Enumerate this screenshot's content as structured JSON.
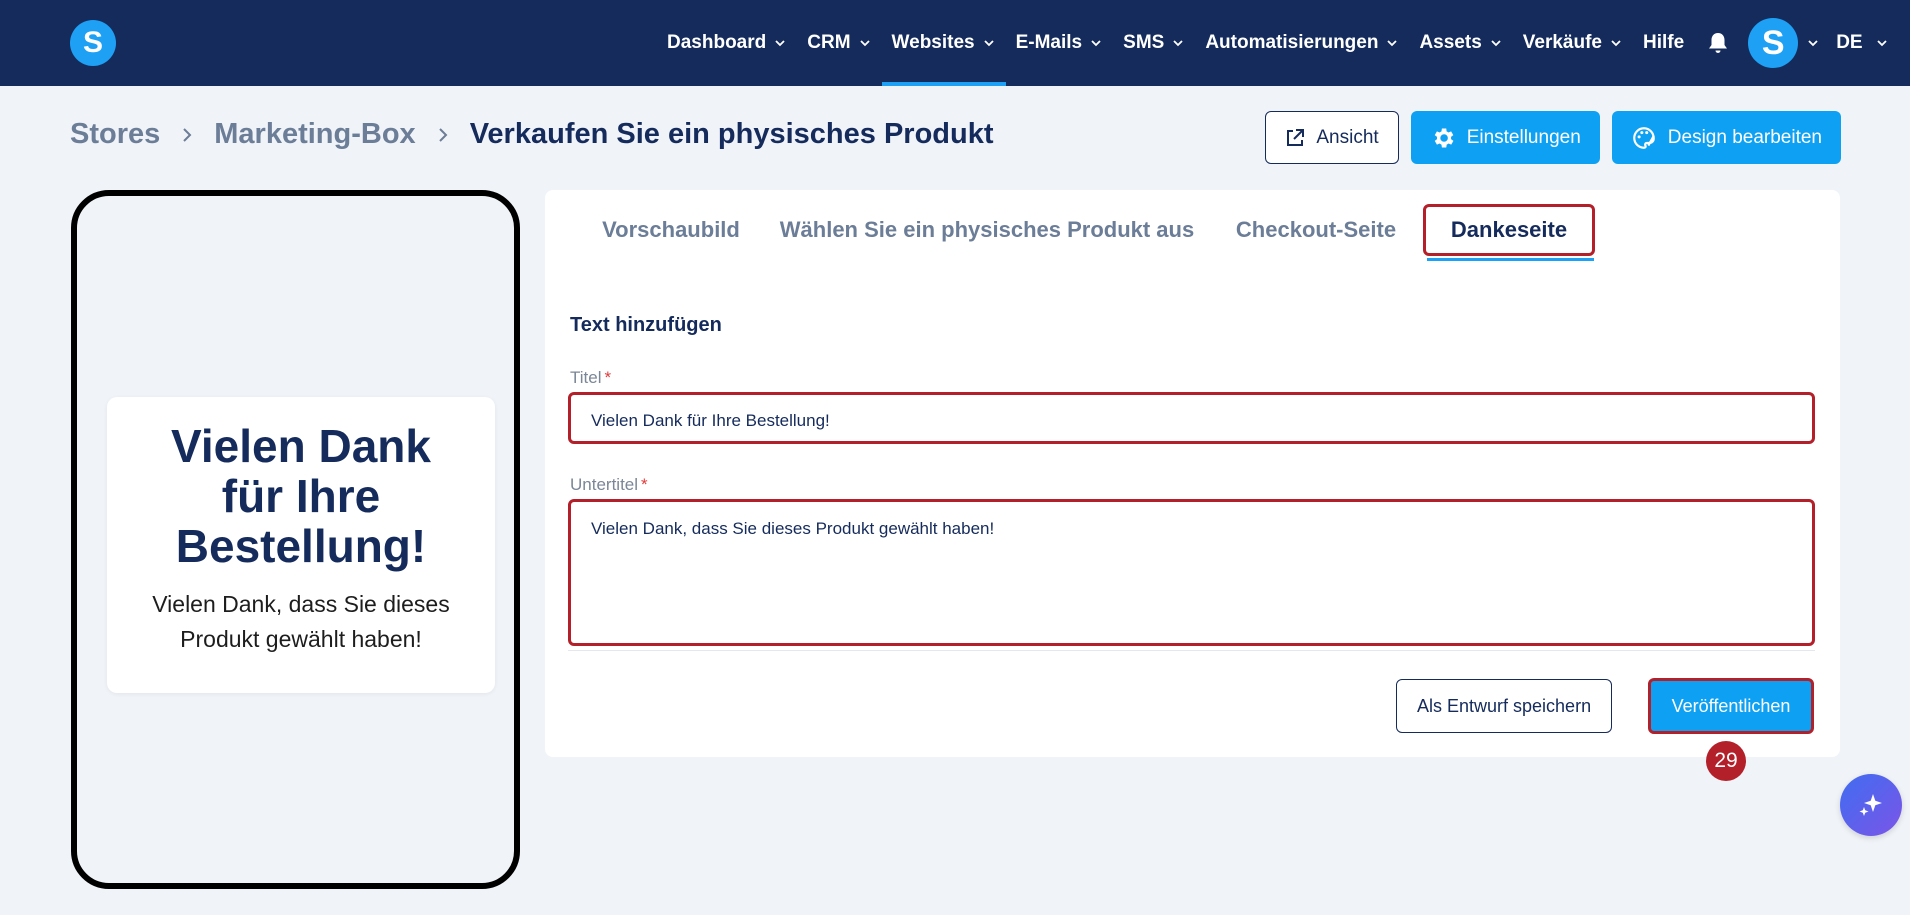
{
  "topnav": {
    "logo_letter": "S",
    "items": [
      {
        "label": "Dashboard"
      },
      {
        "label": "CRM"
      },
      {
        "label": "Websites"
      },
      {
        "label": "E-Mails"
      },
      {
        "label": "SMS"
      },
      {
        "label": "Automatisierungen"
      },
      {
        "label": "Assets"
      },
      {
        "label": "Verkäufe"
      }
    ],
    "help_label": "Hilfe",
    "avatar_letter": "S",
    "language": "DE"
  },
  "breadcrumb": {
    "items": [
      "Stores",
      "Marketing-Box",
      "Verkaufen Sie ein physisches Produkt"
    ]
  },
  "actions": {
    "view_label": "Ansicht",
    "settings_label": "Einstellungen",
    "design_label": "Design bearbeiten"
  },
  "preview": {
    "title": "Vielen Dank für Ihre Bestellung!",
    "subtitle": "Vielen Dank, dass Sie dieses Produkt gewählt haben!"
  },
  "tabs": [
    {
      "label": "Vorschaubild"
    },
    {
      "label": "Wählen Sie ein physisches Produkt aus"
    },
    {
      "label": "Checkout-Seite"
    },
    {
      "label": "Dankeseite"
    }
  ],
  "form": {
    "section_title": "Text hinzufügen",
    "title_label": "Titel",
    "title_value": "Vielen Dank für Ihre Bestellung!",
    "subtitle_label": "Untertitel",
    "subtitle_value": "Vielen Dank, dass Sie dieses Produkt gewählt haben!",
    "required_marker": "*",
    "draft_label": "Als Entwurf speichern",
    "publish_label": "Veröffentlichen"
  },
  "step_badge": "29",
  "colors": {
    "nav_bg": "#152b5c",
    "accent": "#0ea1f3",
    "highlight": "#b3202a"
  }
}
